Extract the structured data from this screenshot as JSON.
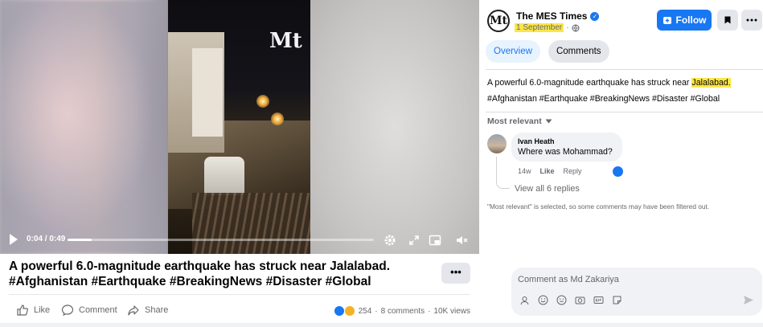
{
  "video": {
    "watermark": "Mt",
    "timecode": "0:04 / 0:49",
    "progress_fraction": 0.08
  },
  "post": {
    "caption": "A powerful 6.0-magnitude earthquake has struck near Jalalabad. #Afghanistan #Earthquake #BreakingNews #Disaster #Global",
    "more_label": "•••",
    "actions": {
      "like": "Like",
      "comment": "Comment",
      "share": "Share"
    },
    "stats": {
      "reactions": "254",
      "comments": "8 comments",
      "views": "10K views",
      "separator": "·"
    }
  },
  "sidebar": {
    "page_name": "The MES Times",
    "verified_mark": "✓",
    "date": "1 September",
    "privacy_mark": "·",
    "follow_label": "Follow",
    "tabs": [
      {
        "label": "Overview"
      },
      {
        "label": "Comments"
      }
    ],
    "post_text_main": "A powerful 6.0-magnitude earthquake has struck near ",
    "post_text_highlight": "Jalalabad.",
    "post_hashtags": "#Afghanistan #Earthquake #BreakingNews #Disaster #Global",
    "sort_label": "Most relevant",
    "comment": {
      "author": "Ivan Heath",
      "text": "Where was Mohammad?",
      "age": "14w",
      "like": "Like",
      "reply": "Reply"
    },
    "view_replies": "View all 6 replies",
    "filter_note": "\"Most relevant\" is selected, so some comments may have been filtered out.",
    "composer_placeholder": "Comment as Md Zakariya"
  },
  "colors": {
    "accent": "#1877f2",
    "highlight": "#fbe64a",
    "secondary_text": "#65676b",
    "button_grey": "#e4e6eb"
  }
}
